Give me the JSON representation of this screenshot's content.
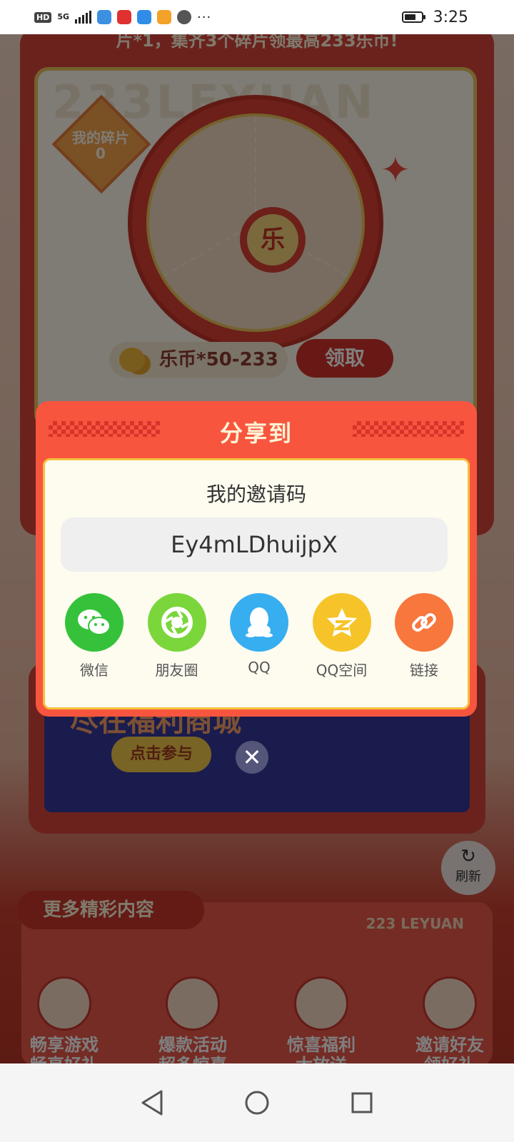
{
  "status_bar": {
    "hd": "HD",
    "network": "5G",
    "more": "···",
    "time": "3:25",
    "battery_level": 0.7,
    "app_icon_colors": [
      "#3d8fe0",
      "#e03030",
      "#2f8de8",
      "#f2a228",
      "#555555"
    ]
  },
  "background": {
    "banner_text": "片*1，集齐3个碎片领最高233乐币!",
    "watermark": "233LEYUAN",
    "fragments_label": "我的碎片",
    "fragments_count": "0",
    "wheel_center": "乐",
    "coin_range": "乐币*50-233",
    "claim_button": "领取",
    "mall_title": "尽在福利商城",
    "mall_button": "点击参与",
    "refresh_label": "刷新",
    "more_title": "更多精彩内容",
    "leyuan_label": "223 LEYUAN",
    "features": [
      {
        "line1": "畅享游戏",
        "line2": "畅享好礼"
      },
      {
        "line1": "爆款活动",
        "line2": "超多惊喜"
      },
      {
        "line1": "惊喜福利",
        "line2": "大放送"
      },
      {
        "line1": "邀请好友",
        "line2": "领好礼"
      }
    ]
  },
  "share_dialog": {
    "title": "分享到",
    "invite_label": "我的邀请码",
    "invite_code": "Ey4mLDhuijpX",
    "options": [
      {
        "label": "微信",
        "icon": "wechat-icon",
        "color": "#35c23a"
      },
      {
        "label": "朋友圈",
        "icon": "moments-icon",
        "color": "#7ad63a"
      },
      {
        "label": "QQ",
        "icon": "qq-icon",
        "color": "#37aef0"
      },
      {
        "label": "QQ空间",
        "icon": "qzone-icon",
        "color": "#f6c428"
      },
      {
        "label": "链接",
        "icon": "link-icon",
        "color": "#f7773d"
      }
    ]
  }
}
